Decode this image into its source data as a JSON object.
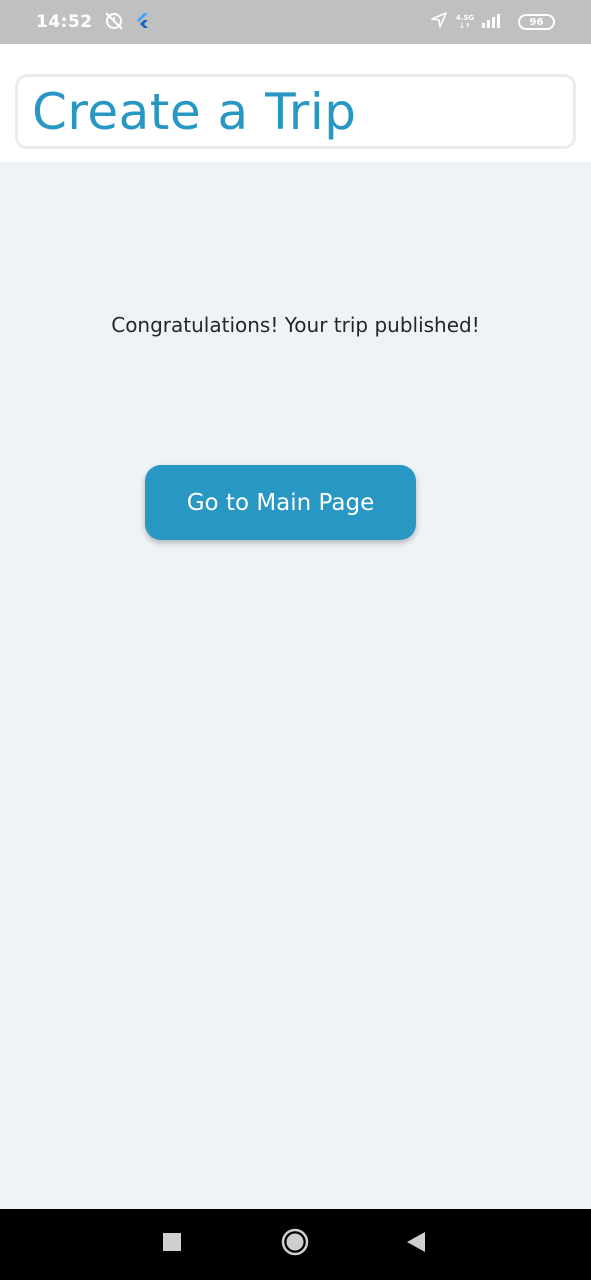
{
  "status_bar": {
    "time": "14:52",
    "network_type": "4.5G",
    "battery_level": "96",
    "icons": [
      "alarm-off-icon",
      "flutter-icon",
      "location-icon",
      "signal-icon",
      "battery-icon"
    ]
  },
  "header": {
    "title": "Create a Trip"
  },
  "main": {
    "message": "Congratulations! Your trip published!",
    "button_label": "Go to Main Page"
  },
  "nav_bar": {
    "icons": [
      "recents-icon",
      "home-icon",
      "back-icon"
    ]
  },
  "colors": {
    "accent": "#2897c3",
    "background": "#eff2f7",
    "status_bar": "#c0c0c0",
    "nav_bar": "#000000"
  }
}
